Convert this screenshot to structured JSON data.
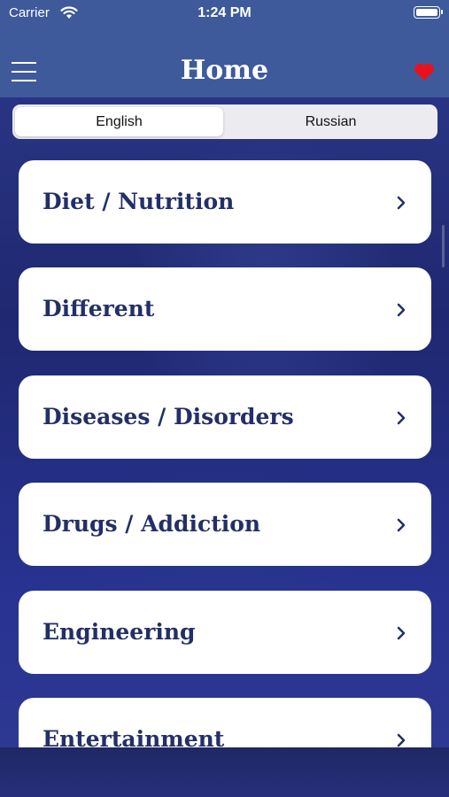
{
  "status_bar": {
    "carrier": "Carrier",
    "time": "1:24 PM"
  },
  "header": {
    "title": "Home",
    "menu_icon": "hamburger-menu-icon",
    "favorite_icon": "heart-icon",
    "favorite_color": "#e8121d"
  },
  "language_selector": {
    "options": [
      "English",
      "Russian"
    ],
    "selected": "English"
  },
  "categories": [
    {
      "label": "Diet / Nutrition"
    },
    {
      "label": "Different"
    },
    {
      "label": "Diseases / Disorders"
    },
    {
      "label": "Drugs / Addiction"
    },
    {
      "label": "Engineering"
    },
    {
      "label": "Entertainment"
    }
  ],
  "colors": {
    "header_bg": "#3e5a9b",
    "card_text": "#232f66",
    "background": "#26307a"
  }
}
